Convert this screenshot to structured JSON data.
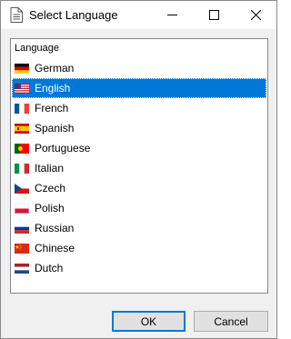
{
  "window": {
    "title": "Select Language",
    "icon": "document-icon",
    "controls": [
      "minimize-icon",
      "maximize-icon",
      "close-icon"
    ]
  },
  "list": {
    "header": "Language",
    "selected": "English",
    "items": [
      {
        "label": "German",
        "flag": "flag-germany-icon"
      },
      {
        "label": "English",
        "flag": "flag-usa-icon"
      },
      {
        "label": "French",
        "flag": "flag-france-icon"
      },
      {
        "label": "Spanish",
        "flag": "flag-spain-icon"
      },
      {
        "label": "Portuguese",
        "flag": "flag-portugal-icon"
      },
      {
        "label": "Italian",
        "flag": "flag-italy-icon"
      },
      {
        "label": "Czech",
        "flag": "flag-czech-icon"
      },
      {
        "label": "Polish",
        "flag": "flag-poland-icon"
      },
      {
        "label": "Russian",
        "flag": "flag-russia-icon"
      },
      {
        "label": "Chinese",
        "flag": "flag-china-icon"
      },
      {
        "label": "Dutch",
        "flag": "flag-netherlands-icon"
      }
    ]
  },
  "buttons": {
    "ok": "OK",
    "cancel": "Cancel"
  },
  "colors": {
    "selection": "#0078d7",
    "background": "#f0f0f0"
  }
}
